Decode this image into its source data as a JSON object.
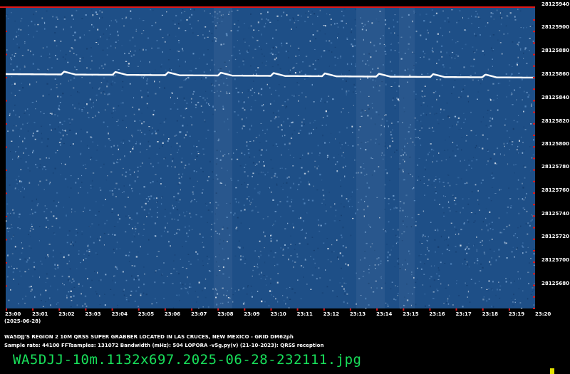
{
  "app": {
    "filename": "WA5DJJ-10m.1132x697.2025-06-28-232111.jpg"
  },
  "spectrogram": {
    "background_color": "#1e4f87",
    "trace_color": "#ffffff",
    "tick_color": "#e01818",
    "frequency_labels": [
      "28125940",
      "28125900",
      "28125880",
      "28125860",
      "28125840",
      "28125820",
      "28125800",
      "28125780",
      "28125760",
      "28125740",
      "28125720",
      "28125700",
      "28125680"
    ],
    "time_labels": [
      "23:00",
      "23:01",
      "23:02",
      "23:03",
      "23:04",
      "23:05",
      "23:06",
      "23:07",
      "23:08",
      "23:09",
      "23:10",
      "23:11",
      "23:12",
      "23:13",
      "23:14",
      "23:15",
      "23:16",
      "23:17",
      "23:18",
      "23:19",
      "23:20"
    ],
    "date_label": "(2025-06-28)"
  },
  "footer": {
    "caption": "WA5DJJ'S REGION 2 10M QRSS SUPER GRABBER LOCATED IN LAS CRUCES, NEW MEXICO - GRID DM62ph",
    "params": "Sample rate: 44100    FFTsamples: 131072    Bandwidth (mHz): 504        LOPORA -v5g.py(v) (21-10-2023): QRSS reception"
  }
}
